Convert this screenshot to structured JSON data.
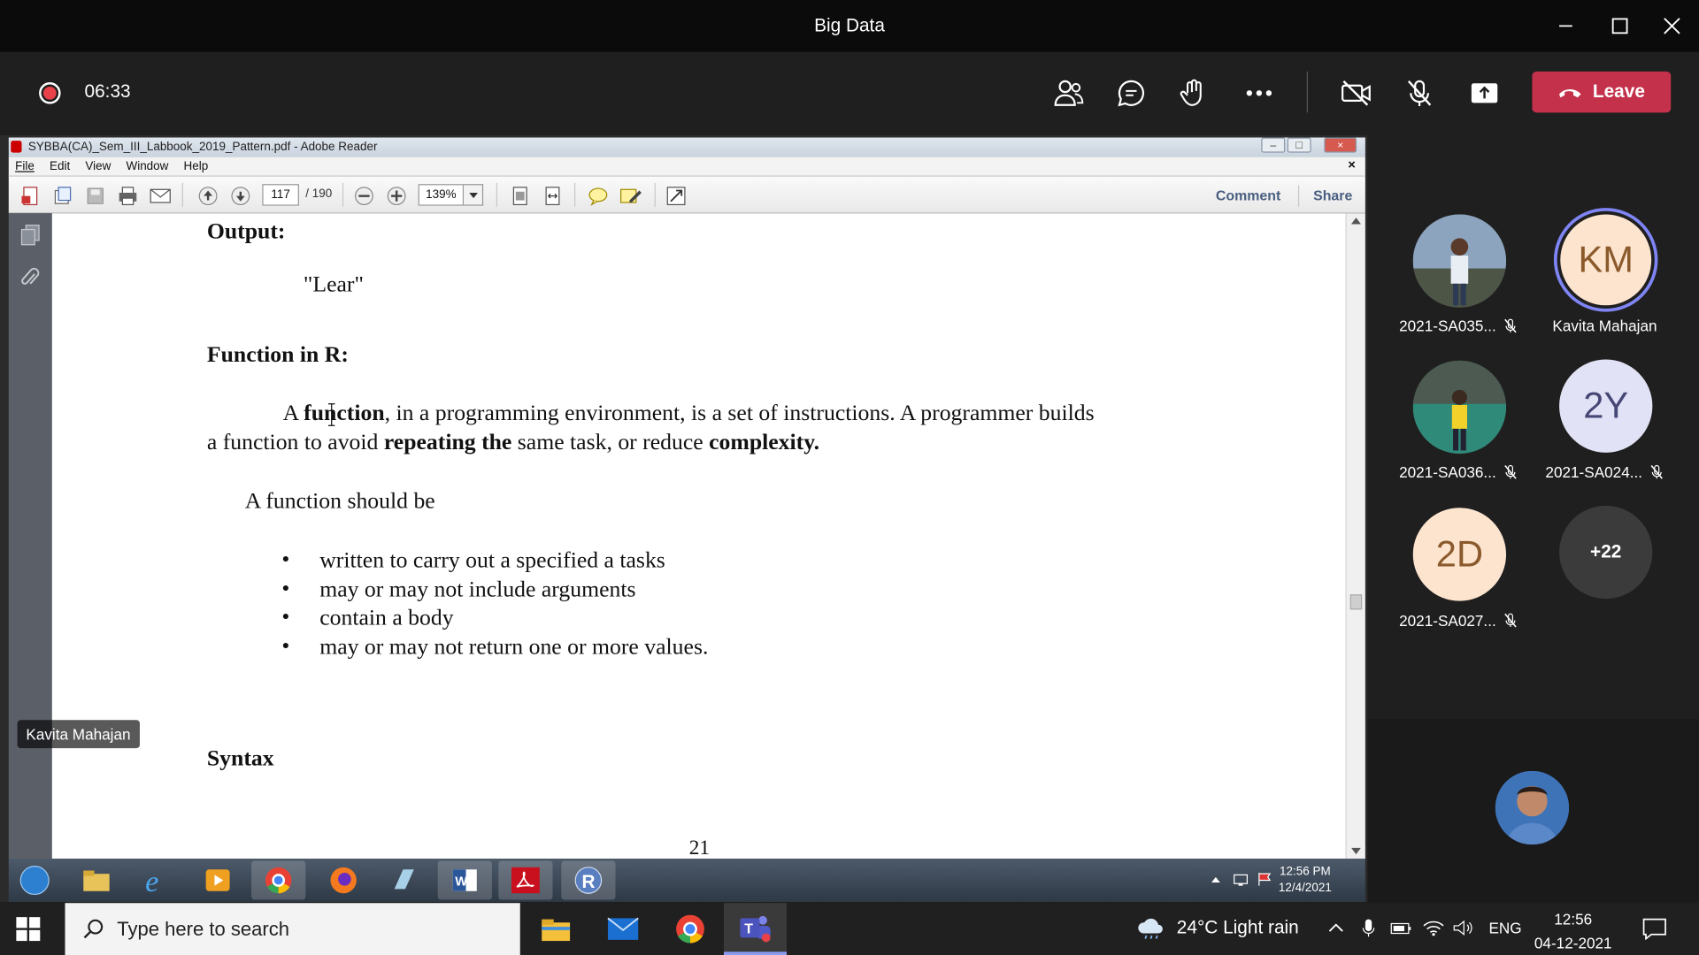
{
  "window": {
    "title": "Big Data"
  },
  "meeting": {
    "timer": "06:33",
    "leave_label": "Leave",
    "accent": "#c4314b",
    "record_color": "#e8414a"
  },
  "reader": {
    "title": "SYBBA(CA)_Sem_III_Labbook_2019_Pattern.pdf - Adobe Reader",
    "menu": [
      "File",
      "Edit",
      "View",
      "Window",
      "Help"
    ],
    "page_current": "117",
    "page_total": "/ 190",
    "zoom": "139%",
    "comment_label": "Comment",
    "share_label": "Share"
  },
  "document": {
    "output_heading": "Output:",
    "output_value": "\"Lear\"",
    "function_heading": "Function in R:",
    "para_p1": "A ",
    "para_b1": "function",
    "para_p2": ", in a programming environment, is a set of instructions. A programmer builds",
    "para2_p1": "a function to avoid ",
    "para2_b1": "repeating the",
    "para2_p2": " same task, or reduce ",
    "para2_b2": "complexity.",
    "should_be": "A function should be",
    "bullets": [
      "written to carry out a specified a tasks",
      "may or may not include arguments",
      "contain a body",
      "may or may not return one or more values."
    ],
    "syntax_heading": "Syntax",
    "page_number": "21"
  },
  "presenter_tag": "Kavita Mahajan",
  "remote_clock": {
    "time": "12:56 PM",
    "date": "12/4/2021"
  },
  "participants": [
    {
      "initials": "",
      "name": "2021-SA035...",
      "muted": true
    },
    {
      "initials": "KM",
      "name": "Kavita Mahajan",
      "muted": false
    },
    {
      "initials": "",
      "name": "2021-SA036...",
      "muted": true
    },
    {
      "initials": "2Y",
      "name": "2021-SA024...",
      "muted": true
    },
    {
      "initials": "2D",
      "name": "2021-SA027...",
      "muted": true
    },
    {
      "initials": "+22",
      "name": "",
      "muted": false
    }
  ],
  "taskbar": {
    "search_placeholder": "Type here to search",
    "weather": "24°C  Light rain",
    "language": "ENG",
    "time": "12:56",
    "date": "04-12-2021"
  }
}
